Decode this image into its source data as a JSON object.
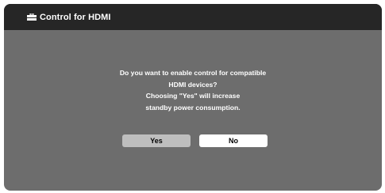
{
  "dialog": {
    "title": "Control for HDMI",
    "title_icon": "toolbox-icon",
    "message_lines": [
      "Do you want to enable control for compatible",
      "HDMI devices?",
      "Choosing \"Yes\" will increase",
      "standby power consumption."
    ],
    "buttons": {
      "yes_label": "Yes",
      "no_label": "No"
    },
    "selected_button": "Yes"
  },
  "colors": {
    "title_bar": "#262626",
    "background": "#6d6d6d",
    "text": "#ffffff",
    "yes_button_focused": "#bebebe",
    "no_button": "#ffffff"
  }
}
